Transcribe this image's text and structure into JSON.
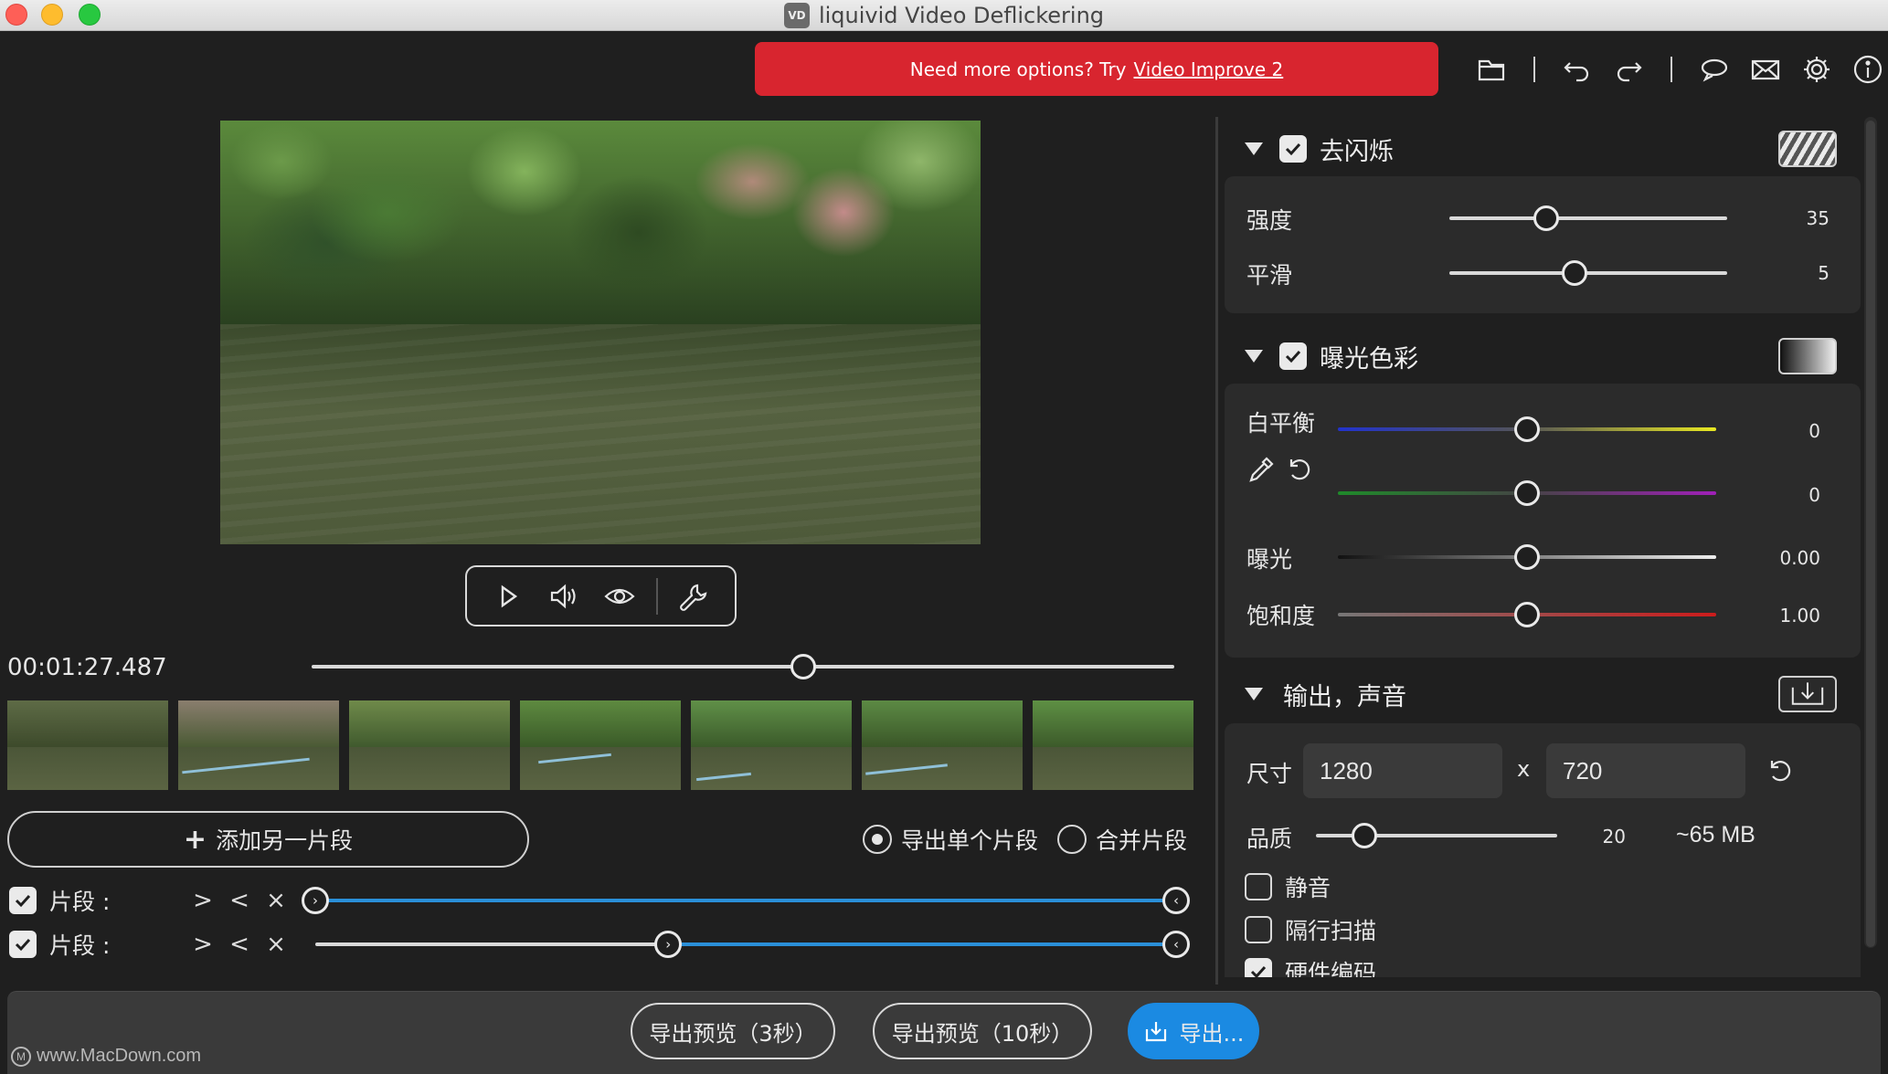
{
  "window": {
    "title": "liquivid Video Deflickering",
    "logo_text": "VD"
  },
  "promo": {
    "text": "Need more options? Try",
    "link": "Video Improve 2",
    "color": "#d8252f"
  },
  "toolbar": {
    "icons": [
      "folder-icon",
      "undo-icon",
      "redo-icon",
      "chat-icon",
      "mail-icon",
      "gear-icon",
      "info-icon"
    ]
  },
  "player": {
    "timecode": "00:01:27.487",
    "timeline_position": 0.57,
    "buttons": [
      "play-icon",
      "speaker-icon",
      "eye-icon",
      "wrench-icon"
    ]
  },
  "segments": {
    "add_label": "添加另一片段",
    "export_single_label": "导出单个片段",
    "merge_label": "合并片段",
    "selected_mode": "export_single",
    "rows": [
      {
        "label": "片段 :",
        "checked": true,
        "start": 0.0,
        "end": 1.0
      },
      {
        "label": "片段 :",
        "checked": true,
        "start": 0.41,
        "end": 1.0
      }
    ],
    "row_icons": [
      ">",
      "<",
      "×"
    ]
  },
  "panel": {
    "deflicker": {
      "title": "去闪烁",
      "enabled": true,
      "strength": {
        "label": "强度",
        "value": "35",
        "level": 0.35
      },
      "smooth": {
        "label": "平滑",
        "value": "5",
        "level": 0.45
      }
    },
    "color": {
      "title": "曝光色彩",
      "enabled": true,
      "white_balance": {
        "label": "白平衡",
        "value_a": "0",
        "value_b": "0",
        "level_a": 0.5,
        "level_b": 0.5
      },
      "exposure": {
        "label": "曝光",
        "value": "0.00",
        "level": 0.5
      },
      "saturation": {
        "label": "饱和度",
        "value": "1.00",
        "level": 0.5
      }
    },
    "output": {
      "title": "输出，声音",
      "size_label": "尺寸",
      "width": "1280",
      "x": "x",
      "height": "720",
      "quality_label": "品质",
      "quality_value": "20",
      "quality_level": 0.2,
      "size_estimate": "~65 MB",
      "mute_label": "静音",
      "mute": false,
      "interlace_label": "隔行扫描",
      "interlace": false,
      "hw_label": "硬件编码",
      "hw": true
    }
  },
  "export": {
    "preview3": "导出预览（3秒）",
    "preview10": "导出预览（10秒）",
    "export": "导出...",
    "accent": "#1b8ae2"
  },
  "watermark": {
    "logo_text": "M",
    "text": "www.MacDown.com"
  }
}
